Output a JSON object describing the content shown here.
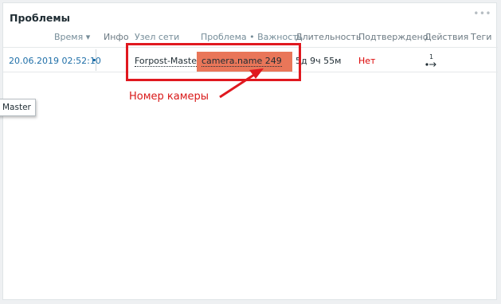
{
  "widget": {
    "title": "Проблемы",
    "menu_label": "•••"
  },
  "columns": {
    "time": "Время ▾",
    "info": "Инфо",
    "host": "Узел сети",
    "problem": "Проблема • Важность",
    "duration": "Длительность",
    "ack": "Подтверждено",
    "actions": "Действия",
    "tags": "Теги"
  },
  "rows": [
    {
      "time": "20.06.2019 02:52:10",
      "info": "",
      "host": "Forpost-Master",
      "problem": "camera.name 249",
      "duration": "5д 9ч 55м",
      "ack": "Нет",
      "actions_count": "1",
      "tags": ""
    }
  ],
  "tooltip": {
    "text": "Master"
  },
  "annotation": {
    "label": "Номер камеры"
  },
  "colors": {
    "severity_high": "#e97659",
    "annotation_red": "#e0181f",
    "link_blue": "#1f6fa8",
    "ack_no": "#dc0000"
  },
  "icons": {
    "actions": "actions-arrow-icon",
    "menu": "ellipsis-icon",
    "sort": "sort-down-icon"
  }
}
